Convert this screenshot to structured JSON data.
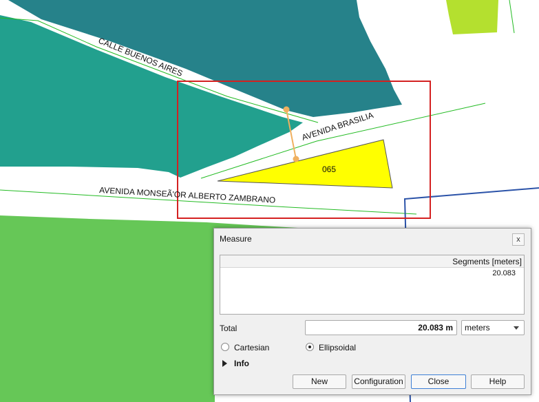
{
  "map": {
    "street_labels": {
      "calle_buenos_aires": "CALLE BUENOS AIRES",
      "avenida_brasilia": "AVENIDA BRASILIA",
      "avenida_monsenor": "AVENIDA MONSEÃ'OR ALBERTO ZAMBRANO"
    },
    "parcel_label": "065",
    "colors": {
      "teal_dark": "#26828a",
      "teal_light": "#22a08e",
      "green": "#66c757",
      "lime": "#b4e02f",
      "parcel": "#ffff00",
      "street_line": "#22bb22",
      "selection": "#d42020",
      "boundary": "#2a52a8",
      "measure_line": "#f0b060"
    }
  },
  "measure_dialog": {
    "title": "Measure",
    "close_glyph": "x",
    "segments_header": "Segments [meters]",
    "segments": [
      "20.083"
    ],
    "total_label": "Total",
    "total_value": "20.083 m",
    "unit_selected": "meters",
    "radio_cartesian": "Cartesian",
    "radio_ellipsoidal": "Ellipsoidal",
    "selected_mode": "Ellipsoidal",
    "info_label": "Info",
    "buttons": {
      "new": "New",
      "configuration": "Configuration",
      "close": "Close",
      "help": "Help"
    }
  }
}
